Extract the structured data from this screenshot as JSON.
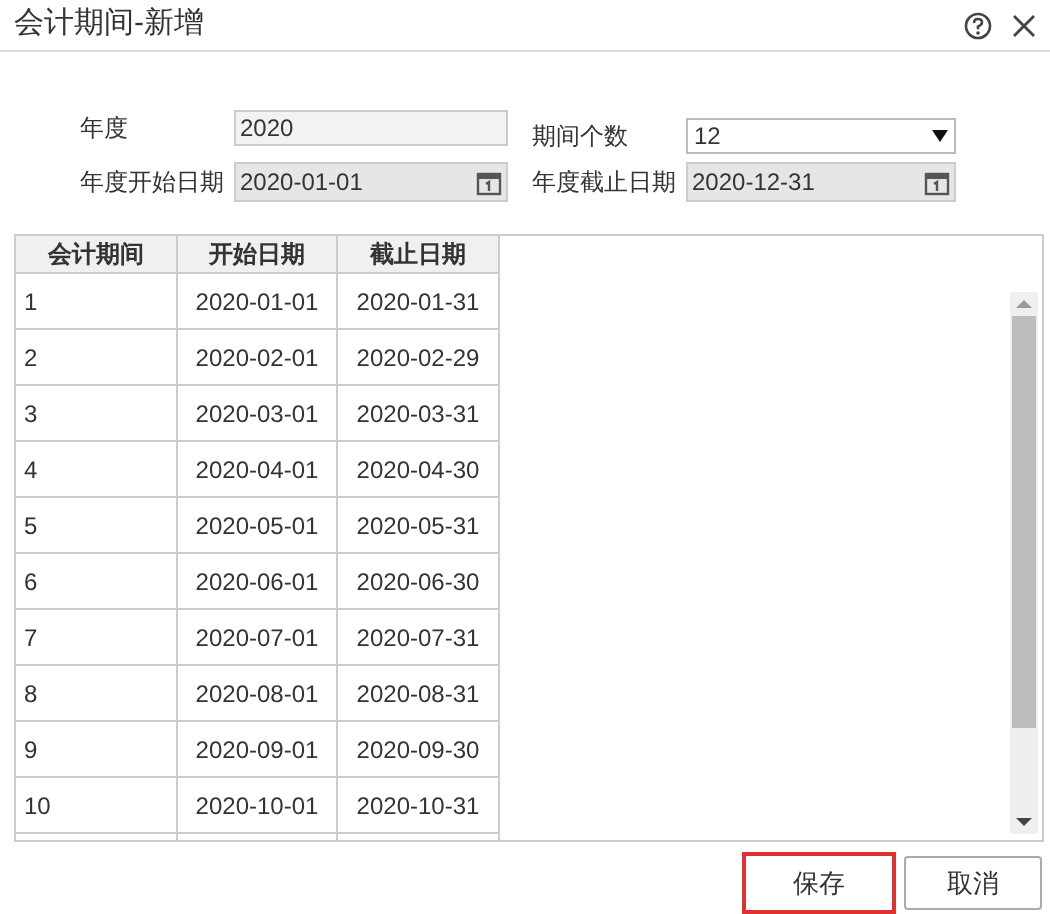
{
  "window": {
    "title": "会计期间-新增"
  },
  "form": {
    "year": {
      "label": "年度",
      "value": "2020"
    },
    "period_count": {
      "label": "期间个数",
      "value": "12"
    },
    "start_date": {
      "label": "年度开始日期",
      "value": "2020-01-01"
    },
    "end_date": {
      "label": "年度截止日期",
      "value": "2020-12-31"
    }
  },
  "table": {
    "columns": [
      "会计期间",
      "开始日期",
      "截止日期"
    ],
    "rows": [
      [
        "1",
        "2020-01-01",
        "2020-01-31"
      ],
      [
        "2",
        "2020-02-01",
        "2020-02-29"
      ],
      [
        "3",
        "2020-03-01",
        "2020-03-31"
      ],
      [
        "4",
        "2020-04-01",
        "2020-04-30"
      ],
      [
        "5",
        "2020-05-01",
        "2020-05-31"
      ],
      [
        "6",
        "2020-06-01",
        "2020-06-30"
      ],
      [
        "7",
        "2020-07-01",
        "2020-07-31"
      ],
      [
        "8",
        "2020-08-01",
        "2020-08-31"
      ],
      [
        "9",
        "2020-09-01",
        "2020-09-30"
      ],
      [
        "10",
        "2020-10-01",
        "2020-10-31"
      ]
    ]
  },
  "buttons": [
    {
      "label": "保存",
      "highlighted": true
    },
    {
      "label": "取消",
      "highlighted": false
    }
  ]
}
